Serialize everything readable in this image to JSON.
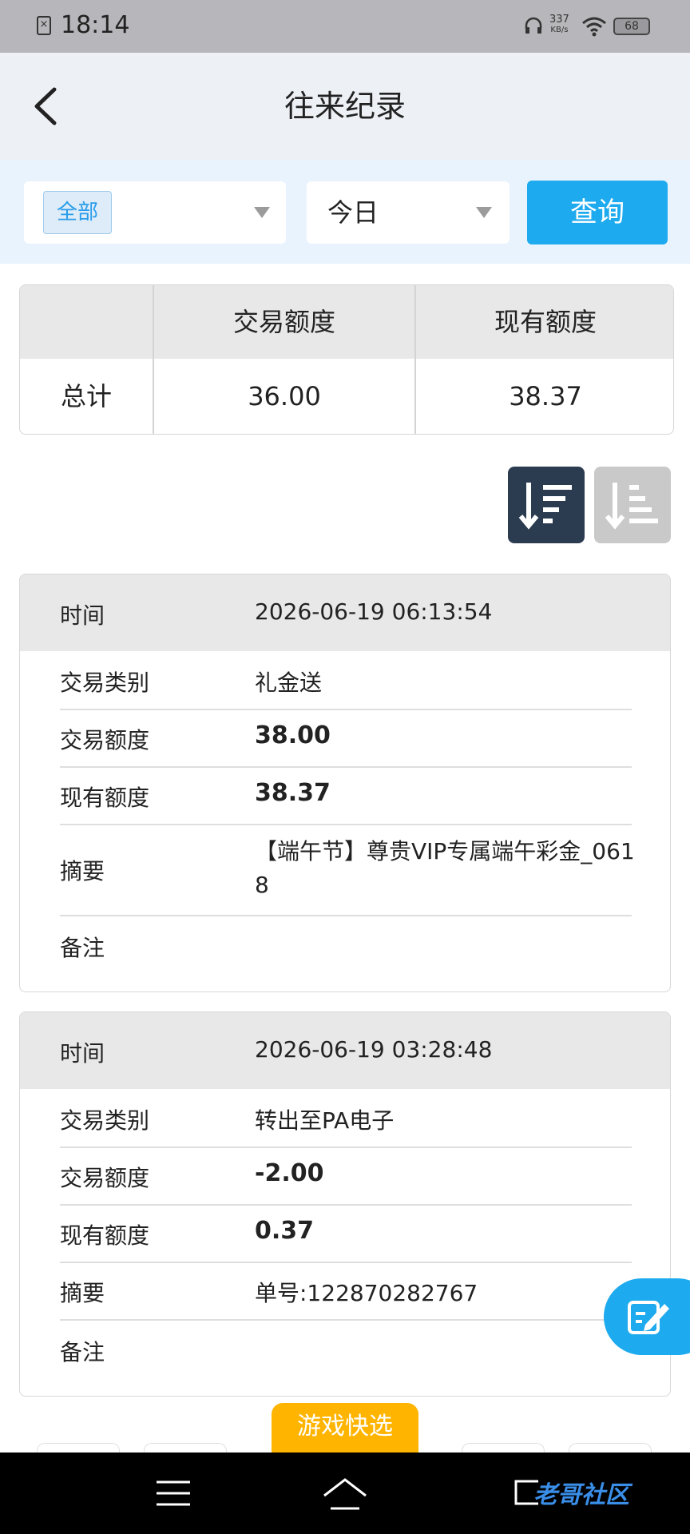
{
  "status_bar": {
    "time": "18:14",
    "network_speed": "337",
    "network_unit": "KB/s",
    "battery": "68"
  },
  "header": {
    "title": "往来纪录",
    "back_icon": "chevron-left-icon"
  },
  "filters": {
    "type_selected": "全部",
    "date_selected": "今日",
    "query_button": "查询"
  },
  "summary": {
    "columns": [
      "",
      "交易额度",
      "现有额度"
    ],
    "row_label": "总计",
    "trade_amount": "36.00",
    "current_amount": "38.37"
  },
  "labels": {
    "time": "时间",
    "type": "交易类别",
    "amount": "交易额度",
    "balance": "现有额度",
    "summary": "摘要",
    "remark": "备注"
  },
  "records": [
    {
      "time": "2026-06-19 06:13:54",
      "type": "礼金送",
      "amount": "38.00",
      "balance": "38.37",
      "summary": "【端午节】尊贵VIP专属端午彩金_0618",
      "remark": ""
    },
    {
      "time": "2026-06-19 03:28:48",
      "type": "转出至PA电子",
      "amount": "-2.00",
      "balance": "0.37",
      "summary": "单号:122870282767",
      "remark": ""
    }
  ],
  "quick_select": "游戏快选",
  "watermark": "老哥社区",
  "colors": {
    "accent": "#1daaee",
    "sort_active": "#2b3b50",
    "quick_tab": "#ffb400"
  }
}
